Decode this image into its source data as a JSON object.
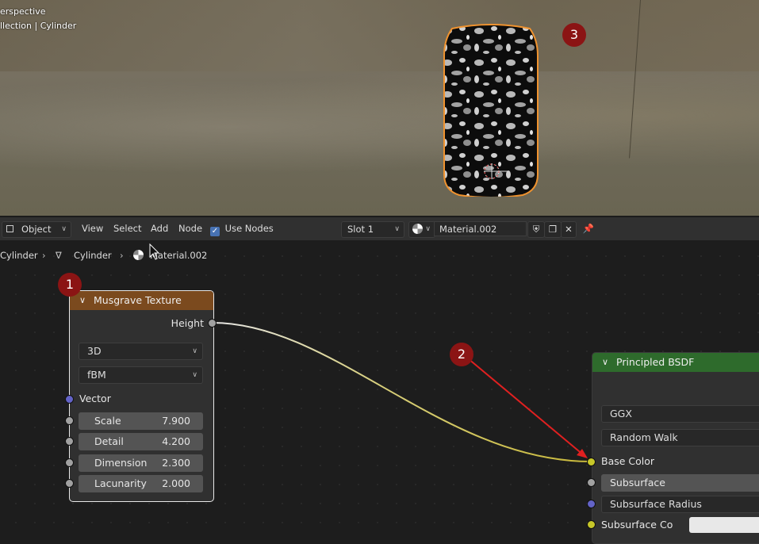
{
  "viewport": {
    "view_label": "erspective",
    "collection_label": "llection | Cylinder",
    "badge": "3"
  },
  "header": {
    "mode": "Object",
    "menu": [
      "View",
      "Select",
      "Add",
      "Node"
    ],
    "use_nodes_label": "Use Nodes",
    "use_nodes_checked": true,
    "slot": "Slot 1",
    "material_name": "Material.002"
  },
  "breadcrumb": [
    "Cylinder",
    "Cylinder",
    "Material.002"
  ],
  "musgrave": {
    "badge": "1",
    "title": "Musgrave Texture",
    "output": "Height",
    "dimensions": "3D",
    "type": "fBM",
    "vector_label": "Vector",
    "fields": [
      {
        "label": "Scale",
        "value": "7.900"
      },
      {
        "label": "Detail",
        "value": "4.200"
      },
      {
        "label": "Dimension",
        "value": "2.300"
      },
      {
        "label": "Lacunarity",
        "value": "2.000"
      }
    ]
  },
  "annotation2": {
    "badge": "2"
  },
  "bsdf": {
    "title": "Principled BSDF",
    "distribution": "GGX",
    "subsurface_method": "Random Walk",
    "base_color_label": "Base Color",
    "subsurface_label": "Subsurface",
    "subsurface_radius_label": "Subsurface Radius",
    "subsurface_color_label": "Subsurface Co"
  },
  "colors": {
    "musgrave_header": "#7b4a1e",
    "bsdf_header": "#2e6b2c",
    "badge": "#8b1414",
    "selection_outline": "#f0932f",
    "link": "#c8b83a",
    "socket_color": "#c7c729",
    "socket_gray": "#a1a1a1",
    "socket_vector": "#6363c7"
  }
}
